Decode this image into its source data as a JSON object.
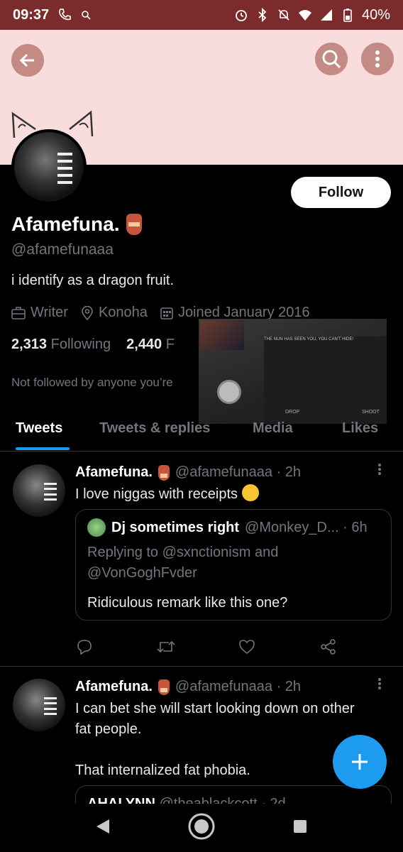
{
  "status_bar": {
    "time": "09:37",
    "battery": "40%"
  },
  "profile": {
    "name": "Afamefuna.",
    "handle": "@afamefunaaa",
    "bio": "i identify as a dragon fruit.",
    "profession": "Writer",
    "location": "Konoha",
    "joined": "Joined January 2016",
    "following_count": "2,313",
    "following_label": "Following",
    "followers_count": "2,440",
    "followers_label": "F",
    "not_followed": "Not followed by anyone you’re",
    "follow_label": "Follow"
  },
  "video": {
    "caption": "THE NUN HAS SEEN YOU, YOU CAN'T HIDE!",
    "drop_label": "DROP",
    "shoot_label": "SHOOT"
  },
  "tabs": [
    "Tweets",
    "Tweets & replies",
    "Media",
    "Likes"
  ],
  "tweets": [
    {
      "name": "Afamefuna.",
      "handle_time": "@afamefunaaa · 2h",
      "text": "I love niggas with receipts",
      "quote": {
        "name": "Dj sometimes right",
        "handle_time": "@Monkey_D... · 6h",
        "reply_line1": "Replying to @sxnctionism and",
        "reply_line2": "@VonGoghFvder",
        "text": "Ridiculous remark like this one?"
      }
    },
    {
      "name": "Afamefuna.",
      "handle_time": "@afamefunaaa · 2h",
      "text_line1": "I can bet she will start looking down on other",
      "text_line2": "fat people.",
      "text_line3": "That internalized fat phobia.",
      "quote_peek": {
        "name": "AHALYNN",
        "handle_time": "@theablackcott · 2d"
      }
    }
  ],
  "colors": {
    "accent": "#1d9bf0",
    "banner": "#f9dcdc",
    "status_bar": "#7b2b2b"
  }
}
